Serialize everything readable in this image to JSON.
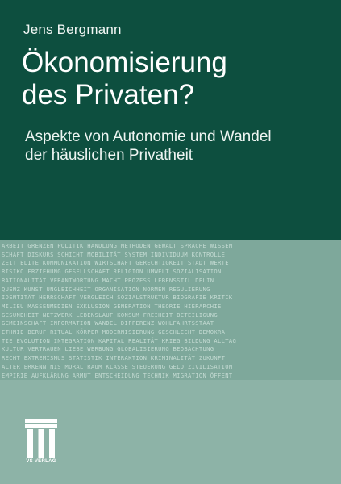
{
  "author": "Jens Bergmann",
  "title_lines": [
    "Ökonomisierung",
    "des Privaten?"
  ],
  "subtitle_lines": [
    "Aspekte von Autonomie und Wandel",
    "der häuslichen Privatheit"
  ],
  "keyword_lines": [
    "ARBEIT GRENZEN POLITIK HANDLUNG METHODEN GEWALT SPRACHE WISSEN",
    "SCHAFT DISKURS SCHICHT MOBILITÄT SYSTEM INDIVIDUUM KONTROLLE",
    "ZEIT ELITE KOMMUNIKATION WIRTSCHAFT GERECHTIGKEIT STADT WERTE",
    "RISIKO ERZIEHUNG GESELLSCHAFT RELIGION UMWELT SOZIALISATION",
    "RATIONALITÄT VERANTWORTUNG MACHT PROZESS LEBENSSTIL DELIN",
    "QUENZ KUNST UNGLEICHHEIT ORGANISATION NORMEN REGULIERUNG",
    "IDENTITÄT HERRSCHAFT VERGLEICH SOZIALSTRUKTUR BIOGRAFIE KRITIK",
    "MILIEU MASSENMEDIEN EXKLUSION GENERATION THEORIE HIERARCHIE",
    "GESUNDHEIT NETZWERK LEBENSLAUF KONSUM FREIHEIT BETEILIGUNG",
    "GEMEINSCHAFT INFORMATION WANDEL DIFFERENZ WOHLFAHRTSSTAAT",
    "ETHNIE BERUF RITUAL KÖRPER MODERNISIERUNG GESCHLECHT DEMOKRA",
    "TIE EVOLUTION INTEGRATION KAPITAL REALITÄT KRIEG BILDUNG ALLTAG",
    "KULTUR VERTRAUEN LIEBE WERBUNG GLOBALISIERUNG BEOBACHTUNG",
    "RECHT EXTREMISMUS STATISTIK INTERAKTION KRIMINALITÄT ZUKUNFT",
    "ALTER ERKENNTNIS MORAL RAUM KLASSE STEUERUNG GELD ZIVILISATION",
    "EMPIRIE AUFKLÄRUNG ARMUT ENTSCHEIDUNG TECHNIK MIGRATION ÖFFENT"
  ],
  "publisher": "VS VERLAG",
  "colors": {
    "top_panel": "#0d4f3f",
    "band": "#7ea89b",
    "bottom_panel": "#8db3a7",
    "keywords": "#c4dbd3"
  }
}
